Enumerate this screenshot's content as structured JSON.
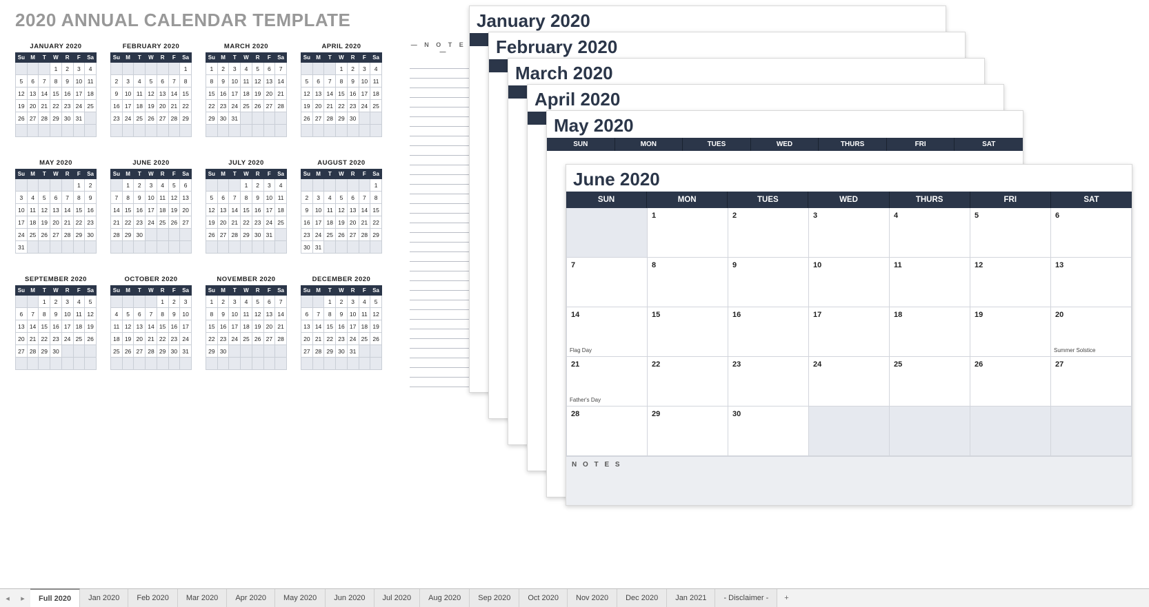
{
  "page_title": "2020 ANNUAL CALENDAR TEMPLATE",
  "notes_label": "— N O T E S —",
  "day_abbr": [
    "Su",
    "M",
    "T",
    "W",
    "R",
    "F",
    "Sa"
  ],
  "day_full": [
    "SUN",
    "MON",
    "TUES",
    "WED",
    "THURS",
    "FRI",
    "SAT"
  ],
  "mini_months": [
    {
      "title": "JANUARY 2020",
      "start": 3,
      "days": 31
    },
    {
      "title": "FEBRUARY 2020",
      "start": 6,
      "days": 29
    },
    {
      "title": "MARCH 2020",
      "start": 0,
      "days": 31
    },
    {
      "title": "APRIL 2020",
      "start": 3,
      "days": 30
    },
    {
      "title": "MAY 2020",
      "start": 5,
      "days": 31
    },
    {
      "title": "JUNE 2020",
      "start": 1,
      "days": 30
    },
    {
      "title": "JULY 2020",
      "start": 3,
      "days": 31
    },
    {
      "title": "AUGUST 2020",
      "start": 6,
      "days": 31
    },
    {
      "title": "SEPTEMBER 2020",
      "start": 2,
      "days": 30
    },
    {
      "title": "OCTOBER 2020",
      "start": 4,
      "days": 31
    },
    {
      "title": "NOVEMBER 2020",
      "start": 0,
      "days": 30
    },
    {
      "title": "DECEMBER 2020",
      "start": 2,
      "days": 31
    }
  ],
  "stack_titles": [
    "January 2020",
    "February 2020",
    "March 2020",
    "April 2020",
    "May 2020",
    "June 2020"
  ],
  "big_month": {
    "title": "June 2020",
    "start": 1,
    "days": 30,
    "events": {
      "14": "Flag Day",
      "20": "Summer Solstice",
      "21": "Father's Day"
    },
    "notes_label": "N O T E S"
  },
  "tabs": [
    "Full 2020",
    "Jan 2020",
    "Feb 2020",
    "Mar 2020",
    "Apr 2020",
    "May 2020",
    "Jun 2020",
    "Jul 2020",
    "Aug 2020",
    "Sep 2020",
    "Oct 2020",
    "Nov 2020",
    "Dec 2020",
    "Jan 2021",
    "- Disclaimer -"
  ],
  "active_tab": 0,
  "nav_left": "◂",
  "nav_right": "▸",
  "add": "+"
}
